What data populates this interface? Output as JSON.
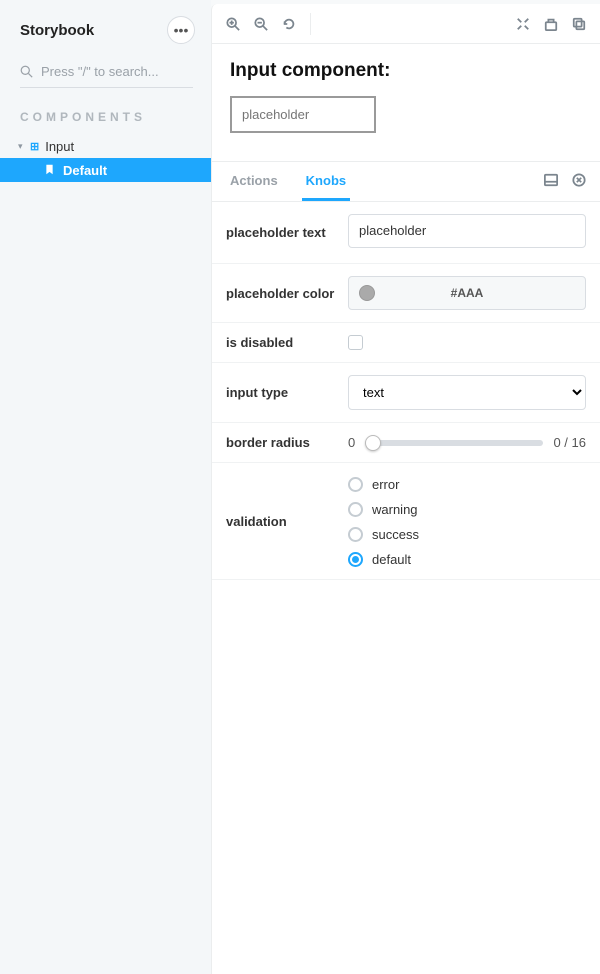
{
  "sidebar": {
    "title": "Storybook",
    "search_placeholder": "Press \"/\" to search...",
    "section_label": "COMPONENTS",
    "tree": {
      "parent_label": "Input",
      "child_label": "Default"
    }
  },
  "preview": {
    "heading": "Input component:",
    "input_placeholder": "placeholder"
  },
  "addons": {
    "tabs": {
      "actions": "Actions",
      "knobs": "Knobs"
    },
    "knobs": {
      "placeholder_text": {
        "label": "placeholder text",
        "value": "placeholder"
      },
      "placeholder_color": {
        "label": "placeholder color",
        "value": "#AAA"
      },
      "is_disabled": {
        "label": "is disabled",
        "checked": false
      },
      "input_type": {
        "label": "input type",
        "value": "text"
      },
      "border_radius": {
        "label": "border radius",
        "value": "0",
        "display_left": "0",
        "display_right": "0 / 16"
      },
      "validation": {
        "label": "validation",
        "options": [
          "error",
          "warning",
          "success",
          "default"
        ],
        "selected": "default"
      }
    }
  }
}
